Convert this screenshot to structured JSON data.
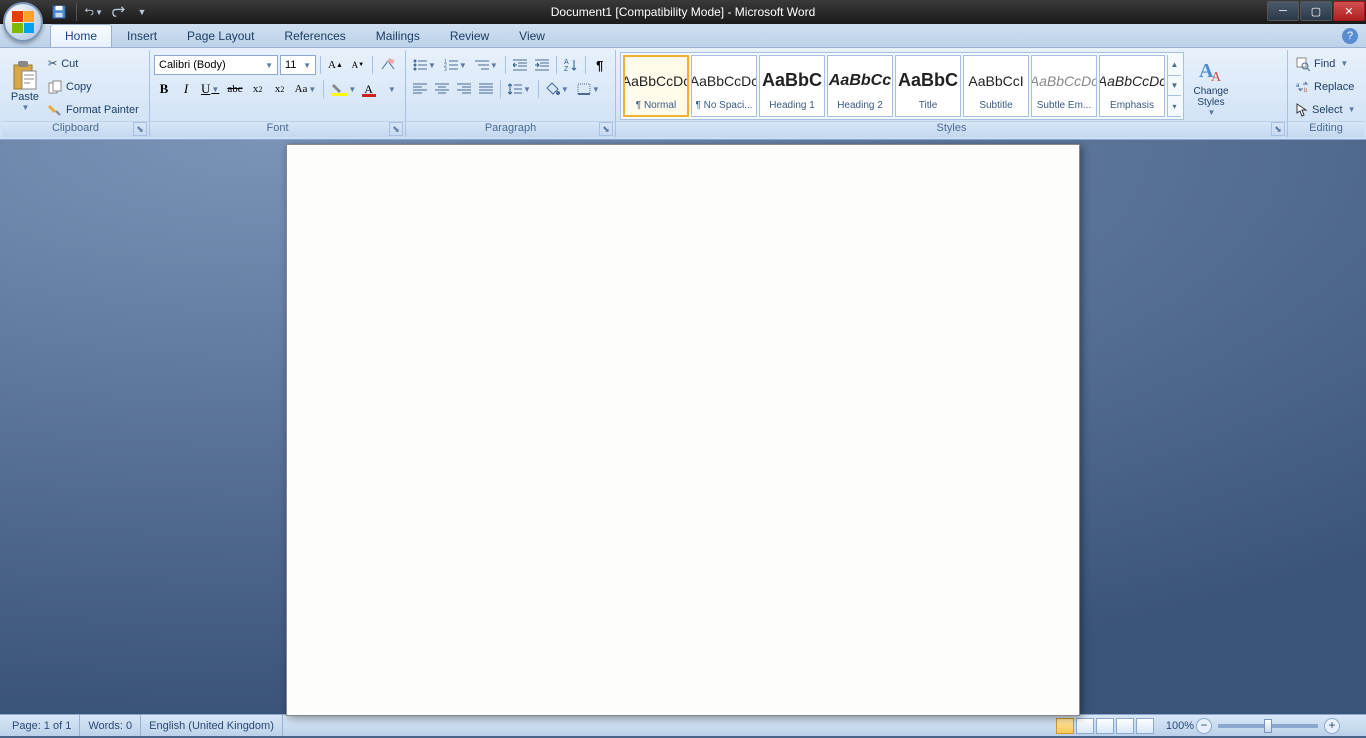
{
  "title": "Document1 [Compatibility Mode] - Microsoft Word",
  "tabs": {
    "home": "Home",
    "insert": "Insert",
    "pagelayout": "Page Layout",
    "references": "References",
    "mailings": "Mailings",
    "review": "Review",
    "view": "View"
  },
  "clipboard": {
    "label": "Clipboard",
    "paste": "Paste",
    "cut": "Cut",
    "copy": "Copy",
    "formatpainter": "Format Painter"
  },
  "font": {
    "label": "Font",
    "name": "Calibri (Body)",
    "size": "11"
  },
  "paragraph": {
    "label": "Paragraph"
  },
  "styles": {
    "label": "Styles",
    "change": "Change Styles",
    "items": [
      {
        "preview": "AaBbCcDc",
        "name": "¶ Normal",
        "cls": ""
      },
      {
        "preview": "AaBbCcDc",
        "name": "¶ No Spaci...",
        "cls": ""
      },
      {
        "preview": "AaBbC",
        "name": "Heading 1",
        "cls": "font-size:18px;font-weight:bold;"
      },
      {
        "preview": "AaBbCc",
        "name": "Heading 2",
        "cls": "font-size:16px;font-style:italic;font-weight:bold;"
      },
      {
        "preview": "AaBbC",
        "name": "Title",
        "cls": "font-size:18px;font-weight:bold;"
      },
      {
        "preview": "AaBbCcI",
        "name": "Subtitle",
        "cls": "font-size:14px;"
      },
      {
        "preview": "AaBbCcDc",
        "name": "Subtle Em...",
        "cls": "font-style:italic;color:#888;"
      },
      {
        "preview": "AaBbCcDc",
        "name": "Emphasis",
        "cls": "font-style:italic;"
      }
    ]
  },
  "editing": {
    "label": "Editing",
    "find": "Find",
    "replace": "Replace",
    "select": "Select"
  },
  "statusbar": {
    "page": "Page: 1 of 1",
    "words": "Words: 0",
    "lang": "English (United Kingdom)",
    "zoom": "100%"
  }
}
